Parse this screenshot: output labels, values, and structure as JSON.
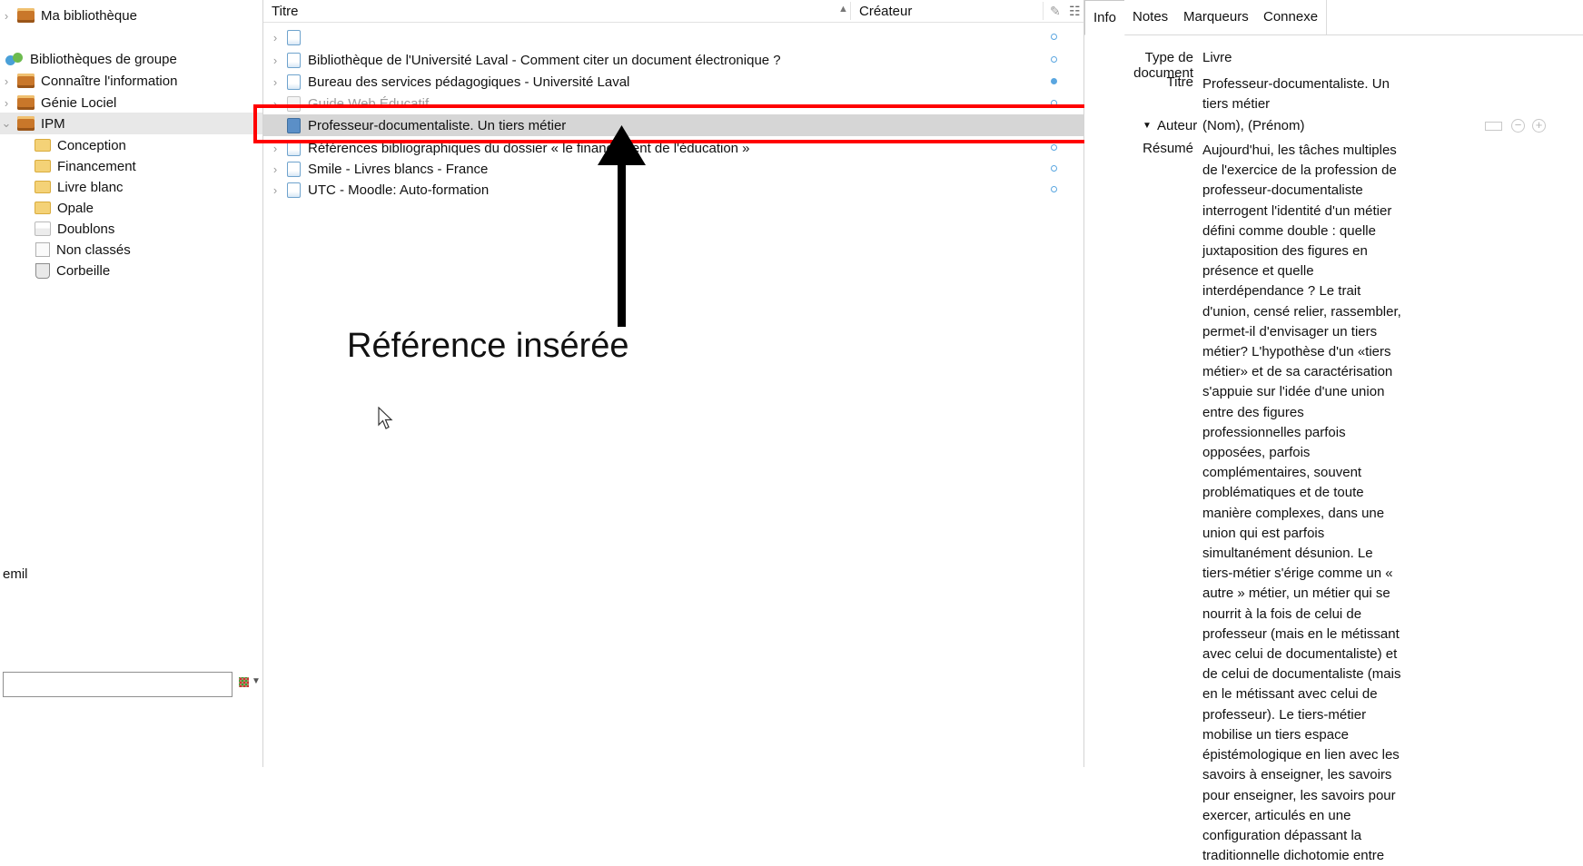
{
  "collections": {
    "my_library": "Ma bibliothèque",
    "group_libraries": "Bibliothèques de groupe",
    "groups": [
      "Connaître l'information",
      "Génie Lociel",
      "IPM"
    ],
    "subcollections": [
      "Conception",
      "Financement",
      "Livre blanc",
      "Opale"
    ],
    "duplicates": "Doublons",
    "unfiled": "Non classés",
    "trash": "Corbeille"
  },
  "tag_selector": {
    "tag": "emil",
    "filter_value": "",
    "filter_placeholder": ""
  },
  "items": {
    "columns": {
      "title": "Titre",
      "creator": "Créateur"
    },
    "rows": [
      {
        "title": "",
        "status": "empty"
      },
      {
        "title": "Bibliothèque de l'Université Laval - Comment citer un document électronique ?",
        "status": "empty"
      },
      {
        "title": "Bureau des services pédagogiques - Université Laval",
        "status": "filled"
      },
      {
        "title": "Guide Web Éducatif",
        "status": "empty"
      },
      {
        "title": "Professeur-documentaliste. Un tiers métier",
        "status": "none"
      },
      {
        "title": "Références bibliographiques du dossier « le financement de l'éducation »",
        "status": "empty"
      },
      {
        "title": "Smile - Livres blancs - France",
        "status": "empty"
      },
      {
        "title": "UTC - Moodle: Auto-formation",
        "status": "empty"
      }
    ],
    "selected_index": 4
  },
  "annotation": {
    "text": "Référence insérée",
    "highlight_color": "#ff0000"
  },
  "item_pane": {
    "tabs": [
      "Info",
      "Notes",
      "Marqueurs",
      "Connexe"
    ],
    "active_tab": "Info",
    "fields": {
      "type_label": "Type de document",
      "type_value": "Livre",
      "title_label": "Titre",
      "title_value": "Professeur-documentaliste. Un tiers métier",
      "author_label": "Auteur",
      "author_value": "(Nom), (Prénom)",
      "abstract_label": "Résumé",
      "abstract_value": "Aujourd'hui, les tâches multiples de l'exercice de la profession de professeur-documentaliste interrogent l'identité d'un métier défini comme double : quelle juxtaposition des figures en présence et quelle interdépendance ? Le trait d'union, censé relier, rassembler, permet-il d'envisager un tiers métier? L'hypothèse d'un «tiers métier» et de sa caractérisation s'appuie sur l'idée d'une union entre des figures professionnelles parfois opposées, parfois complémentaires, souvent problématiques et de toute manière complexes, dans une union qui est parfois simultanément désunion. Le tiers-métier s'érige comme un « autre » métier, un métier qui se nourrit à la fois de celui de professeur (mais en le métissant avec celui de documentaliste) et de celui de documentaliste (mais en le métissant avec celui de professeur). Le tiers-métier mobilise un tiers espace épistémologique en lien avec les savoirs à enseigner, les savoirs pour enseigner, les savoirs pour exercer, articulés en une configuration dépassant la traditionnelle dichotomie entre"
    }
  }
}
